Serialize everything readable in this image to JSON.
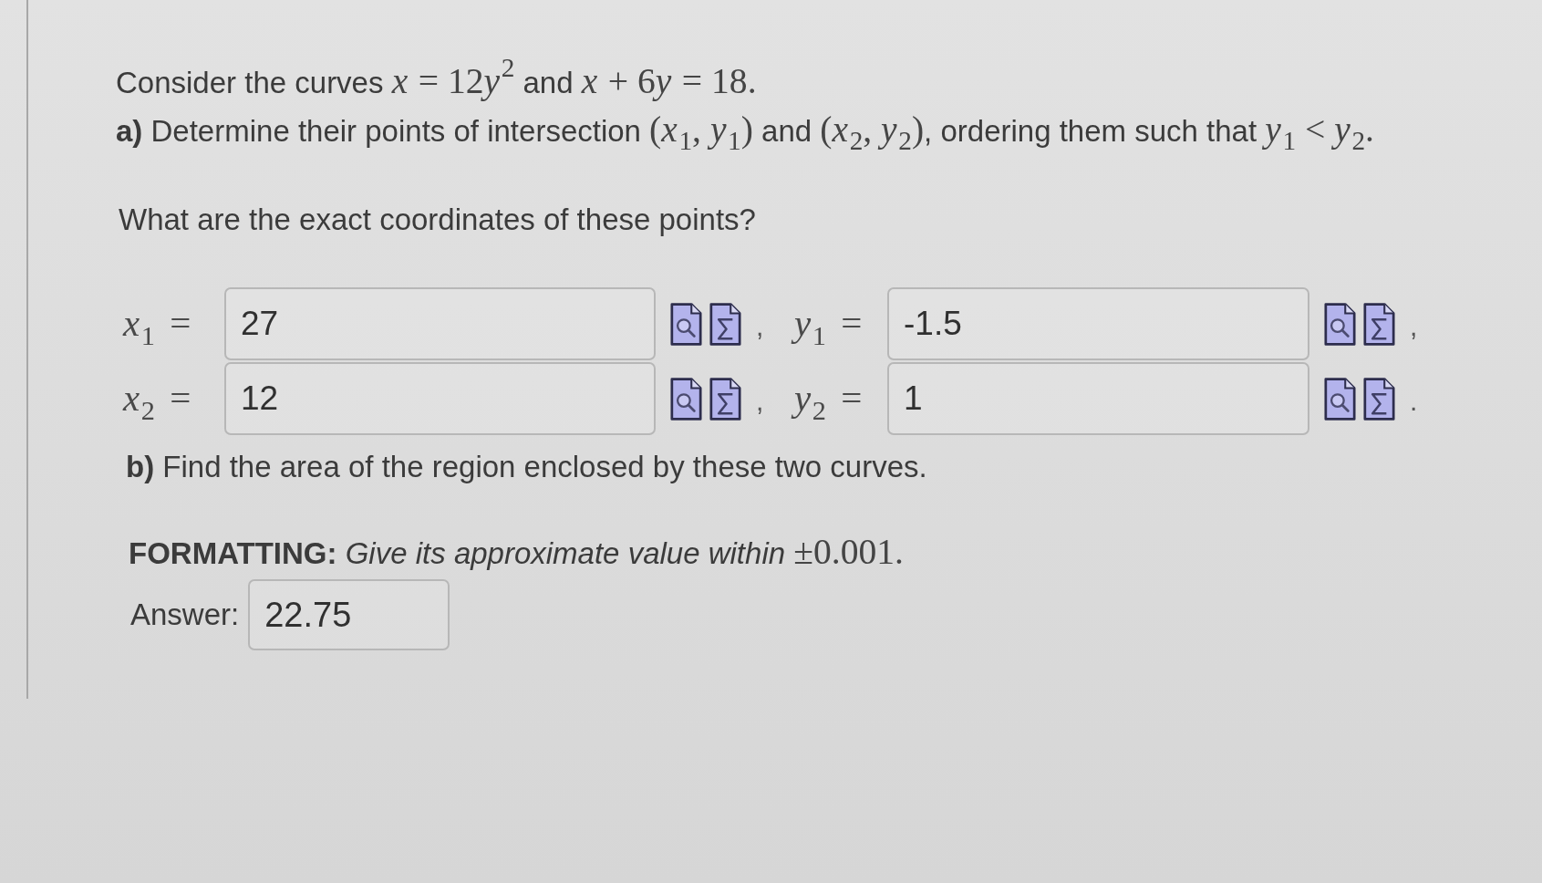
{
  "intro": [
    {
      "kind": "text",
      "text": "Consider the curves "
    },
    {
      "kind": "math",
      "text": "x = 12y$^{2}$"
    },
    {
      "kind": "text",
      "text": " and "
    },
    {
      "kind": "math",
      "text": "x + 6y = 18."
    }
  ],
  "part_a": [
    {
      "kind": "text",
      "text": "**a)** Determine their points of intersection "
    },
    {
      "kind": "math",
      "text": "(x$_{1}$, y$_{1}$)"
    },
    {
      "kind": "text",
      "text": " and "
    },
    {
      "kind": "math",
      "text": "(x$_{2}$, y$_{2}$)"
    },
    {
      "kind": "text",
      "text": ", ordering them such that "
    },
    {
      "kind": "math",
      "text": "y$_{1}$ < y$_{2}$."
    }
  ],
  "question": "What are the exact coordinates of these points?",
  "coordinates": [
    {
      "label": "x$_{1}$ =",
      "value": "27",
      "punctuation": ","
    },
    {
      "label": "y$_{1}$ =",
      "value": "-1.5",
      "punctuation": ","
    },
    {
      "label": "x$_{2}$ =",
      "value": "12",
      "punctuation": ","
    },
    {
      "label": "y$_{2}$ =",
      "value": "1",
      "punctuation": "."
    }
  ],
  "part_b": [
    {
      "kind": "text",
      "text": "**b)** Find the area of the region enclosed by these two curves."
    }
  ],
  "formatting": [
    {
      "kind": "text",
      "text": "**FORMATTING:** *Give its approximate value within* "
    },
    {
      "kind": "math",
      "text": "±0.001."
    }
  ],
  "answer": {
    "label": "Answer:",
    "value": "22.75"
  }
}
